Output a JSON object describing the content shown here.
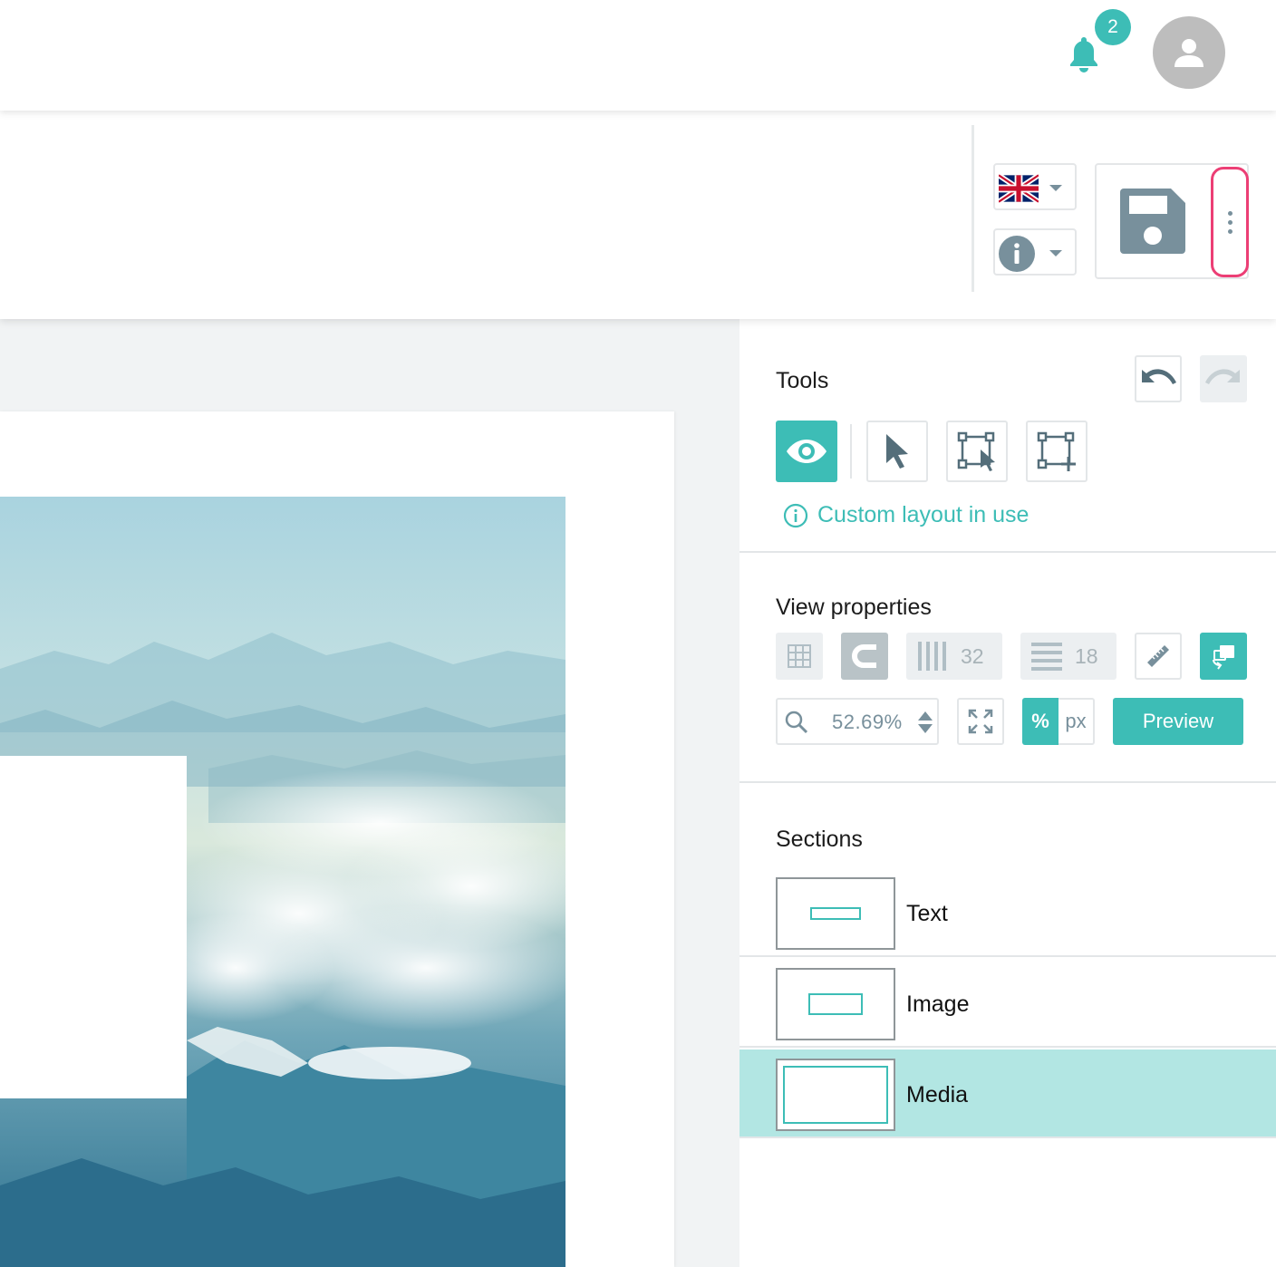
{
  "header": {
    "notifications": {
      "count": "2",
      "icon": "bell-icon"
    },
    "user": {
      "icon": "user-avatar-icon"
    }
  },
  "toolbar": {
    "language": {
      "flag": "uk-flag-icon"
    },
    "info": {
      "icon": "info-icon"
    },
    "save": {
      "icon": "floppy-disk-icon"
    },
    "more": {
      "icon": "vertical-dots-icon"
    }
  },
  "tools": {
    "title": "Tools",
    "notice": "Custom layout in use"
  },
  "view_properties": {
    "title": "View properties",
    "columns": "32",
    "rows": "18",
    "zoom_value": "52.69",
    "zoom_unit": "%",
    "unit_percent": "%",
    "unit_px": "px",
    "preview_label": "Preview"
  },
  "sections": {
    "title": "Sections",
    "items": [
      {
        "label": "Text",
        "active": false
      },
      {
        "label": "Image",
        "active": false
      },
      {
        "label": "Media",
        "active": true
      }
    ]
  },
  "colors": {
    "accent": "#3dbdb6",
    "highlight": "#ec3e75",
    "selected_row": "#b2e6e3",
    "icon_grey": "#78909c"
  }
}
